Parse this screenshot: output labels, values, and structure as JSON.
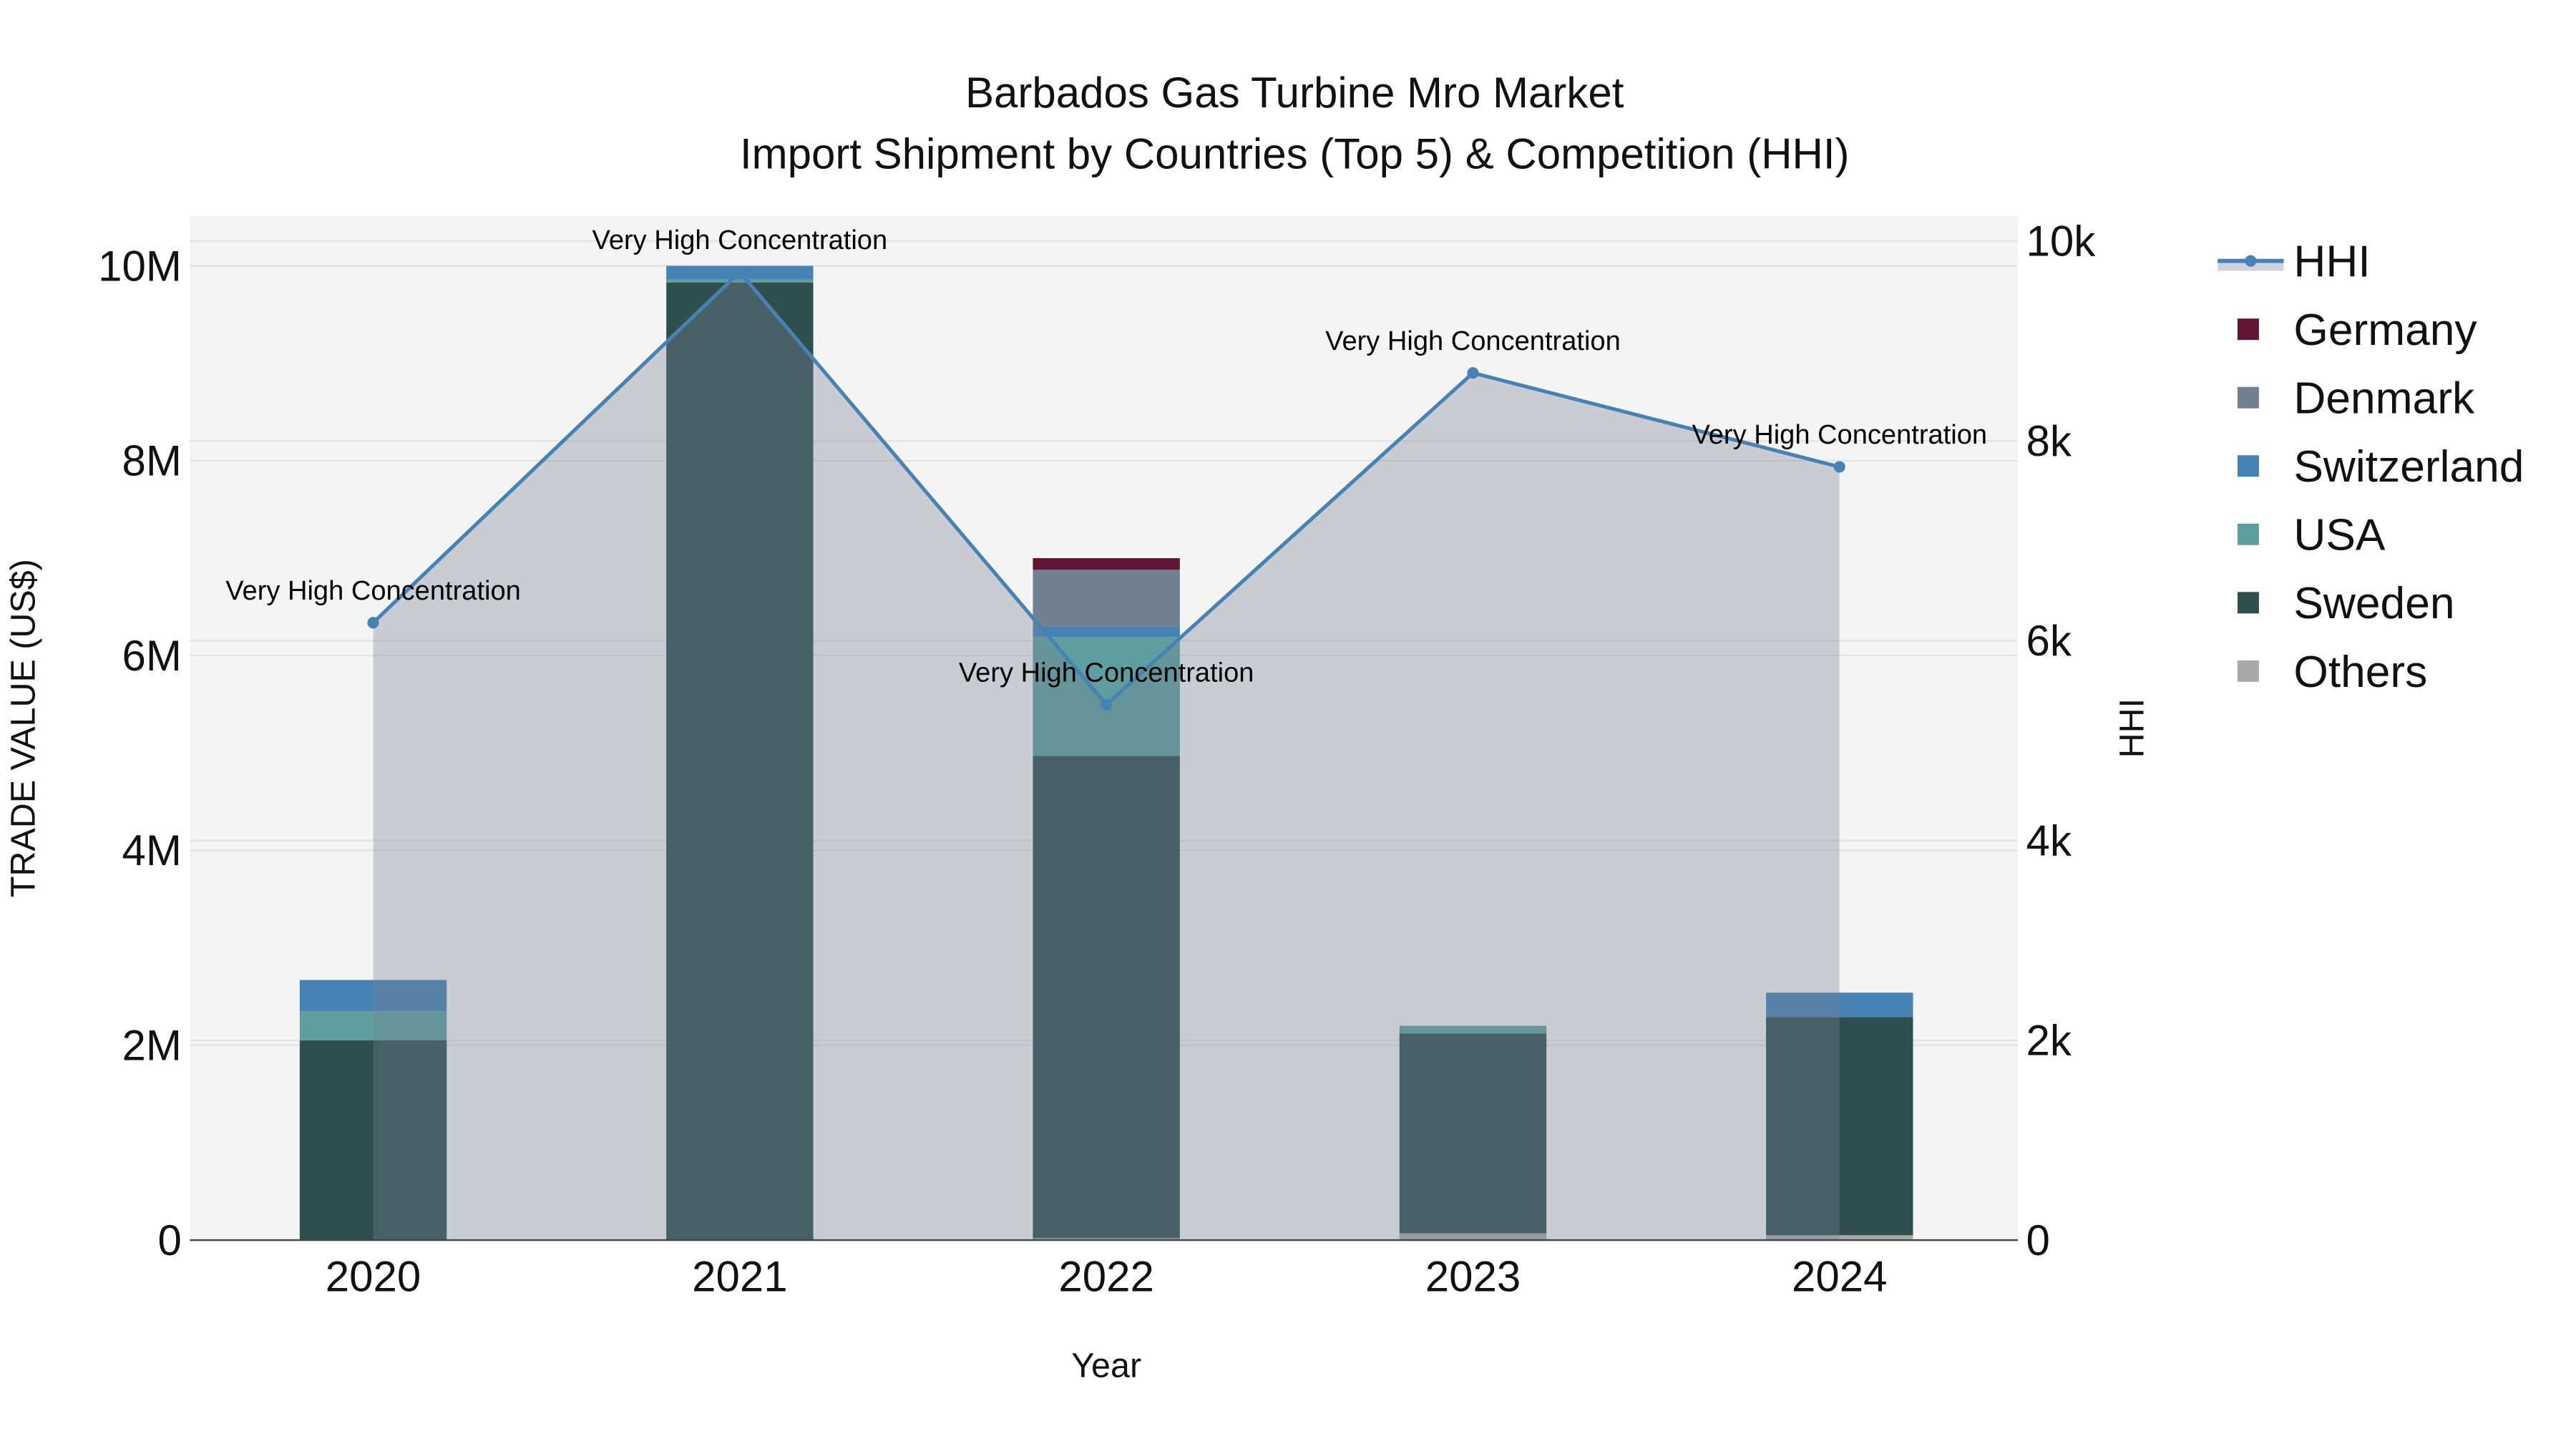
{
  "chart_data": {
    "type": "bar",
    "title": "Barbados Gas Turbine Mro Market",
    "subtitle": "Import Shipment by Countries (Top 5) & Competition (HHI)",
    "xlabel": "Year",
    "ylabel": "TRADE VALUE (US$)",
    "y2label": "HHI",
    "categories": [
      "2020",
      "2021",
      "2022",
      "2023",
      "2024"
    ],
    "ylim": [
      0,
      10500000
    ],
    "y2lim": [
      0,
      10300
    ],
    "yticks": [
      {
        "v": 0,
        "label": "0"
      },
      {
        "v": 2000000,
        "label": "2M"
      },
      {
        "v": 4000000,
        "label": "4M"
      },
      {
        "v": 6000000,
        "label": "6M"
      },
      {
        "v": 8000000,
        "label": "8M"
      },
      {
        "v": 10000000,
        "label": "10M"
      }
    ],
    "y2ticks": [
      {
        "v": 0,
        "label": "0"
      },
      {
        "v": 2000,
        "label": "2k"
      },
      {
        "v": 4000,
        "label": "4k"
      },
      {
        "v": 6000,
        "label": "6k"
      },
      {
        "v": 8000,
        "label": "8k"
      },
      {
        "v": 10000,
        "label": "10k"
      }
    ],
    "grid": true,
    "legend_position": "right",
    "series": [
      {
        "name": "Others",
        "color": "#a9a9a9",
        "values": [
          0,
          0,
          20000,
          70000,
          50000
        ]
      },
      {
        "name": "Sweden",
        "color": "#2f4f4f",
        "values": [
          2050000,
          9830000,
          4950000,
          2050000,
          2240000
        ]
      },
      {
        "name": "USA",
        "color": "#5f9ea0",
        "values": [
          300000,
          30000,
          1220000,
          80000,
          0
        ]
      },
      {
        "name": "Switzerland",
        "color": "#4682b4",
        "values": [
          320000,
          140000,
          110000,
          0,
          250000
        ]
      },
      {
        "name": "Denmark",
        "color": "#708090",
        "values": [
          0,
          0,
          580000,
          0,
          0
        ]
      },
      {
        "name": "Germany",
        "color": "#631535",
        "values": [
          0,
          0,
          120000,
          0,
          0
        ]
      }
    ],
    "legend_order": [
      "HHI",
      "Germany",
      "Denmark",
      "Switzerland",
      "USA",
      "Sweden",
      "Others"
    ],
    "hhi": {
      "name": "HHI",
      "color": "#4682b4",
      "values": [
        6180,
        9690,
        5360,
        8680,
        7740
      ],
      "annotations": [
        "Very High Concentration",
        "Very High Concentration",
        "Very High Concentration",
        "Very High Concentration",
        "Very High Concentration"
      ]
    }
  }
}
